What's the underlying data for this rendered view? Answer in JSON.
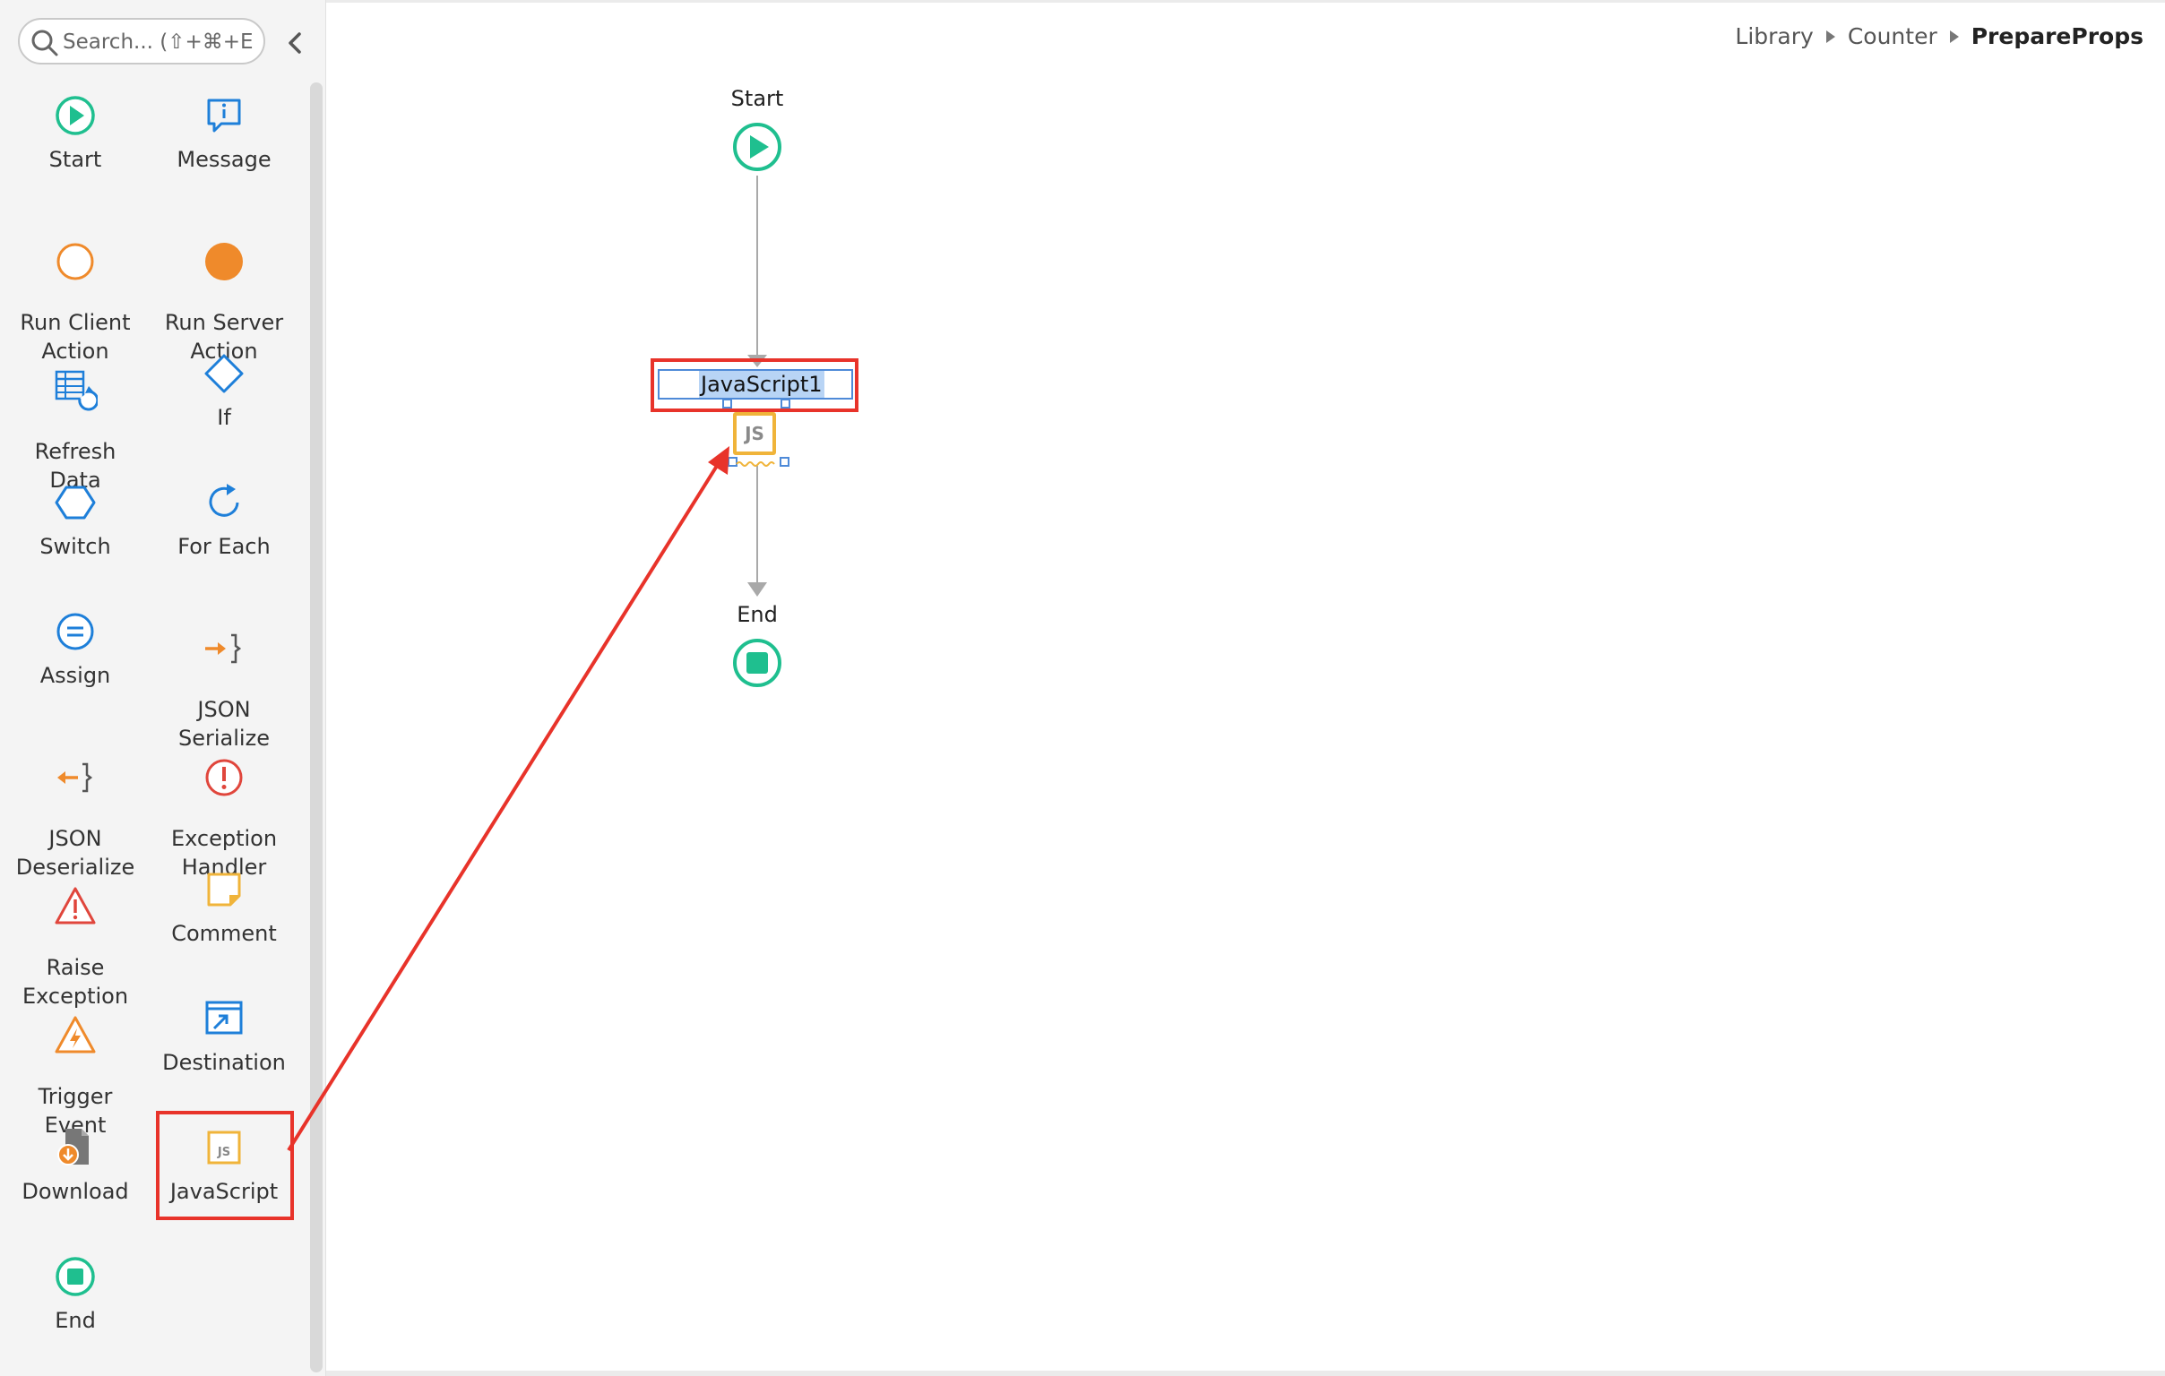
{
  "search": {
    "placeholder": "Search... (⇧+⌘+E"
  },
  "toolbox": {
    "items": [
      {
        "label": "Start",
        "icon": "start-icon"
      },
      {
        "label": "Message",
        "icon": "message-icon"
      },
      {
        "label": "Run Client\nAction",
        "icon": "run-client-action-icon"
      },
      {
        "label": "Run Server\nAction",
        "icon": "run-server-action-icon"
      },
      {
        "label": "Refresh\nData",
        "icon": "refresh-data-icon"
      },
      {
        "label": "If",
        "icon": "if-icon"
      },
      {
        "label": "Switch",
        "icon": "switch-icon"
      },
      {
        "label": "For Each",
        "icon": "for-each-icon"
      },
      {
        "label": "Assign",
        "icon": "assign-icon"
      },
      {
        "label": "JSON\nSerialize",
        "icon": "json-serialize-icon"
      },
      {
        "label": "JSON\nDeserialize",
        "icon": "json-deserialize-icon"
      },
      {
        "label": "Exception\nHandler",
        "icon": "exception-handler-icon"
      },
      {
        "label": "Raise\nException",
        "icon": "raise-exception-icon"
      },
      {
        "label": "Comment",
        "icon": "comment-icon"
      },
      {
        "label": "Trigger\nEvent",
        "icon": "trigger-event-icon"
      },
      {
        "label": "Destination",
        "icon": "destination-icon"
      },
      {
        "label": "Download",
        "icon": "download-icon"
      },
      {
        "label": "JavaScript",
        "icon": "javascript-icon"
      },
      {
        "label": "End",
        "icon": "end-icon"
      }
    ]
  },
  "breadcrumb": {
    "items": [
      "Library",
      "Counter"
    ],
    "current": "PrepareProps"
  },
  "flow": {
    "start_label": "Start",
    "js_node_title": "JavaScript1",
    "js_badge": "JS",
    "end_label": "End"
  },
  "colors": {
    "green": "#1fbf8f",
    "orange": "#ef8a2b",
    "blue": "#1e7fd9",
    "red": "#e0463c",
    "yellow": "#f0b43a",
    "annotation_red": "#e8332a"
  }
}
